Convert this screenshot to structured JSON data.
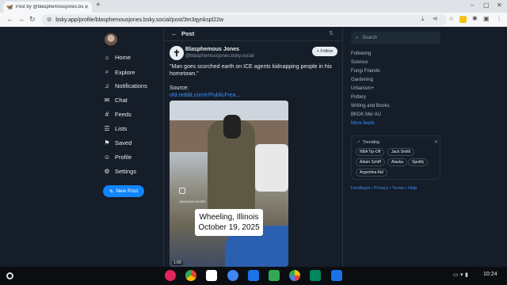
{
  "browser": {
    "tab_title": "Post by @blasphemousjones.bs",
    "url": "bsky.app/profile/blasphemousjones.bsky.social/post/3m3qynkspl22w"
  },
  "nav": {
    "items": [
      {
        "label": "Home",
        "icon": "home-icon",
        "glyph": "⌂"
      },
      {
        "label": "Explore",
        "icon": "search-icon",
        "glyph": "⌕"
      },
      {
        "label": "Notifications",
        "icon": "bell-icon",
        "glyph": "♫"
      },
      {
        "label": "Chat",
        "icon": "chat-icon",
        "glyph": "✉"
      },
      {
        "label": "Feeds",
        "icon": "hash-icon",
        "glyph": "#"
      },
      {
        "label": "Lists",
        "icon": "list-icon",
        "glyph": "☰"
      },
      {
        "label": "Saved",
        "icon": "bookmark-icon",
        "glyph": "⚑"
      },
      {
        "label": "Profile",
        "icon": "user-icon",
        "glyph": "☺"
      },
      {
        "label": "Settings",
        "icon": "gear-icon",
        "glyph": "⚙"
      }
    ],
    "new_post": "New Post"
  },
  "post": {
    "header": "Post",
    "author_name": "Blasphemous Jones",
    "author_handle": "@blasphemousjones.bsky.social",
    "follow_label": "+ Follow",
    "text": "\"Man goes scorched earth on ICE agents kidnapping people in his hometown.\"",
    "source_label": "Source:",
    "source_link": "old.reddit.com/r/PublicFrea...",
    "video_caption_line1": "Wheeling, Illinois",
    "video_caption_line2": "October 19, 2025",
    "video_watermark": "ABRAHAM MIZER",
    "video_duration": "1:09"
  },
  "sidebar": {
    "search_placeholder": "Search",
    "feeds": [
      "Following",
      "Science",
      "Fungi Friends",
      "Gardening",
      "Urbanism+",
      "Pottery",
      "Writing and Books",
      "BKDK Mer AU"
    ],
    "more_feeds": "More feeds",
    "trending_title": "Trending",
    "trending": [
      "NBA Tip-Off",
      "Jack Smith",
      "Adam Schiff",
      "Alaska",
      "Spotify",
      "Argentina Aid"
    ],
    "footer": "Feedback • Privacy • Terms • Help"
  },
  "shelf": {
    "time": "10:24"
  }
}
